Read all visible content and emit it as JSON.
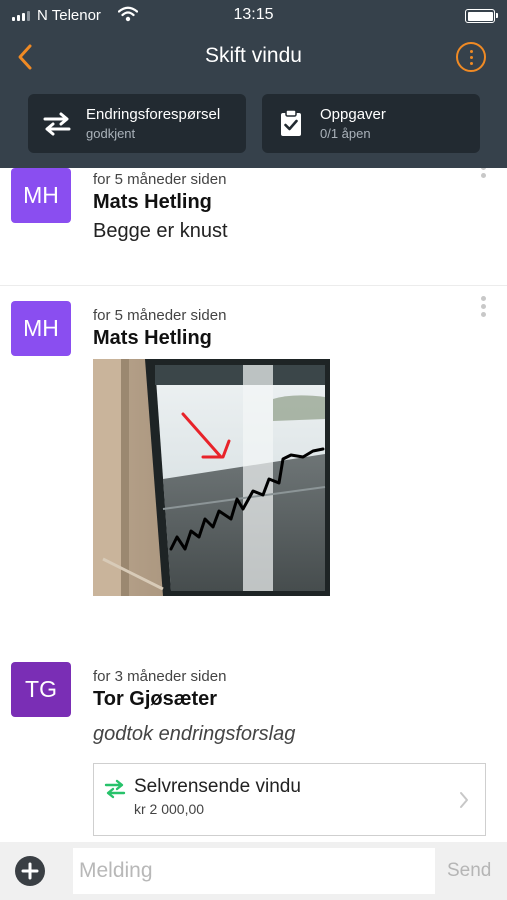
{
  "status_bar": {
    "carrier": "N Telenor",
    "time": "13:15"
  },
  "header": {
    "title": "Skift vindu",
    "change_request": {
      "label": "Endringsforespørsel",
      "status": "godkjent"
    },
    "tasks": {
      "label": "Oppgaver",
      "status": "0/1 åpen"
    }
  },
  "feed": {
    "posts": [
      {
        "avatar": "MH",
        "avatar_color": "#8a4ef0",
        "time": "for 5 måneder siden",
        "author": "Mats Hetling",
        "text": "Begge er knust"
      },
      {
        "avatar": "MH",
        "avatar_color": "#8a4ef0",
        "time": "for 5 måneder siden",
        "author": "Mats Hetling",
        "attachment": "photo"
      },
      {
        "avatar": "TG",
        "avatar_color": "#7a2eb5",
        "time": "for 3 måneder siden",
        "author": "Tor Gjøsæter",
        "text": "godtok endringsforslag"
      }
    ],
    "change_card": {
      "name": "Selvrensende vindu",
      "price": "kr 2 000,00"
    }
  },
  "composer": {
    "placeholder": "Melding",
    "send_label": "Send"
  },
  "colors": {
    "header_bg": "#36414b",
    "chip_bg": "#222a31",
    "accent_orange": "#f08a24",
    "accent_green": "#27c26a"
  },
  "icons": [
    "back-chevron-icon",
    "more-options-icon",
    "swap-arrows-icon",
    "clipboard-check-icon",
    "kebab-menu-icon",
    "chevron-right-icon",
    "add-circle-icon",
    "wifi-icon",
    "signal-icon",
    "battery-icon"
  ]
}
